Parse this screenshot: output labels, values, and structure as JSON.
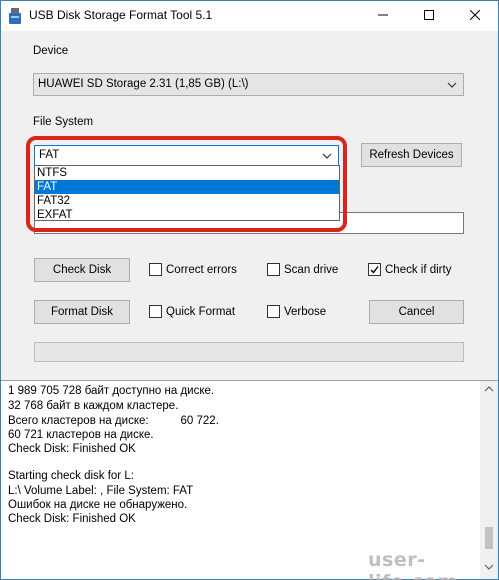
{
  "window": {
    "title": "USB Disk Storage Format Tool 5.1",
    "minimize_icon": "minimize-icon",
    "maximize_icon": "maximize-icon",
    "close_icon": "close-icon"
  },
  "device": {
    "label": "Device",
    "selected": "HUAWEI  SD Storage  2.31 (1,85 GB) (L:\\)"
  },
  "file_system": {
    "label": "File System",
    "selected": "FAT",
    "options": [
      "NTFS",
      "FAT",
      "FAT32",
      "EXFAT"
    ],
    "highlighted_option": "FAT"
  },
  "buttons": {
    "refresh": "Refresh Devices",
    "check_disk": "Check Disk",
    "format_disk": "Format Disk",
    "cancel": "Cancel"
  },
  "options": {
    "correct_errors": {
      "label": "Correct errors",
      "checked": false
    },
    "scan_drive": {
      "label": "Scan drive",
      "checked": false
    },
    "check_if_dirty": {
      "label": "Check if dirty",
      "checked": true
    },
    "quick_format": {
      "label": "Quick Format",
      "checked": false
    },
    "verbose": {
      "label": "Verbose",
      "checked": false
    }
  },
  "log": {
    "lines": [
      "1 989 705 728 байт доступно на диске.",
      "32 768 байт в каждом кластере.",
      "Всего кластеров на диске:          60 722.",
      "60 721 кластеров на диске.",
      "Check Disk: Finished OK",
      "",
      "Starting check disk for L:",
      "L:\\ Volume Label: , File System: FAT",
      "Ошибок на диске не обнаружено.",
      "Check Disk: Finished OK"
    ]
  },
  "watermark": "user-life.com",
  "colors": {
    "highlight": "#d9251d",
    "selection": "#0078d7"
  }
}
